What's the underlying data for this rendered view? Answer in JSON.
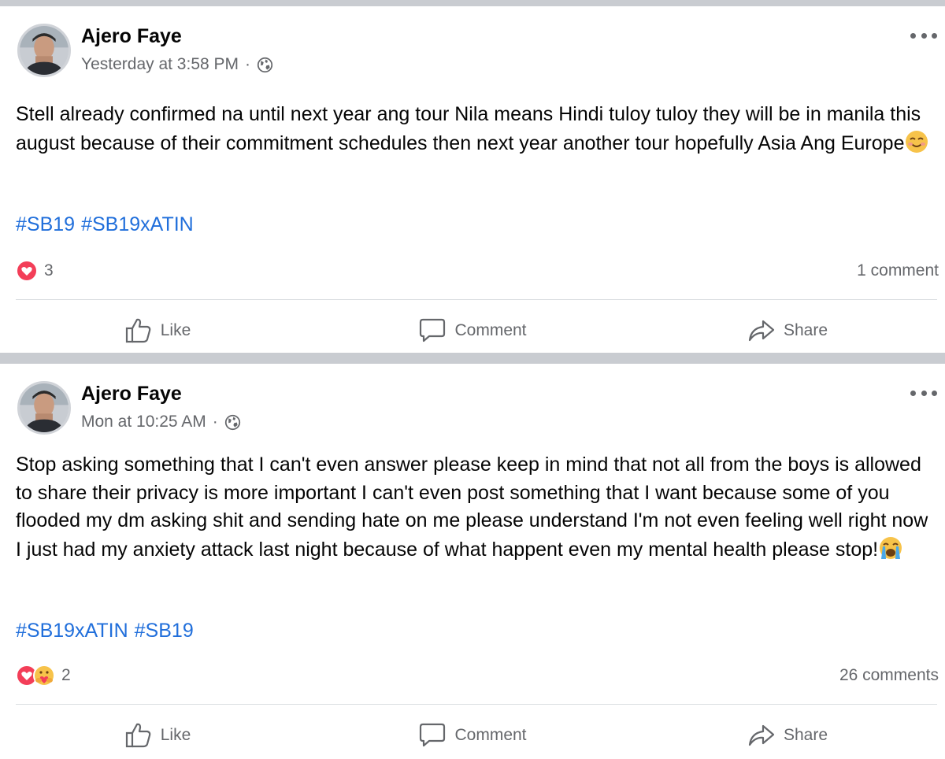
{
  "posts": [
    {
      "author": "Ajero Faye",
      "timestamp": "Yesterday at 3:58 PM",
      "separator": "·",
      "privacy_icon": "globe-icon",
      "body": "Stell already confirmed na until next year ang tour Nila means Hindi tuloy tuloy they will be in manila this august because of their commitment schedules then next year another tour hopefully Asia Ang Europe",
      "body_emoji": "smiling-face-with-smiling-eyes",
      "hashtags": [
        "#SB19",
        "#SB19xATIN"
      ],
      "reactions": [
        "love"
      ],
      "reaction_count": "3",
      "comments": "1 comment",
      "actions": {
        "like": "Like",
        "comment": "Comment",
        "share": "Share"
      }
    },
    {
      "author": "Ajero Faye",
      "timestamp": "Mon at 10:25 AM",
      "separator": "·",
      "privacy_icon": "globe-icon",
      "body": "Stop asking something that I can't even answer please keep in mind that not all from the boys is allowed to share their privacy is more important I can't even post something that I want because some of you flooded my dm asking shit and sending hate on me please understand I'm not even feeling well right now  I just had my anxiety attack last night because of what happent even my mental health please stop!",
      "body_emoji": "loudly-crying-face",
      "hashtags": [
        "#SB19xATIN",
        "#SB19"
      ],
      "reactions": [
        "love",
        "care"
      ],
      "reaction_count": "2",
      "comments": "26 comments",
      "actions": {
        "like": "Like",
        "comment": "Comment",
        "share": "Share"
      }
    }
  ],
  "colors": {
    "hashtag": "#216fdb",
    "secondary_text": "#65676b",
    "divider": "#c9ccd1",
    "love_reaction": "#f33e58"
  }
}
